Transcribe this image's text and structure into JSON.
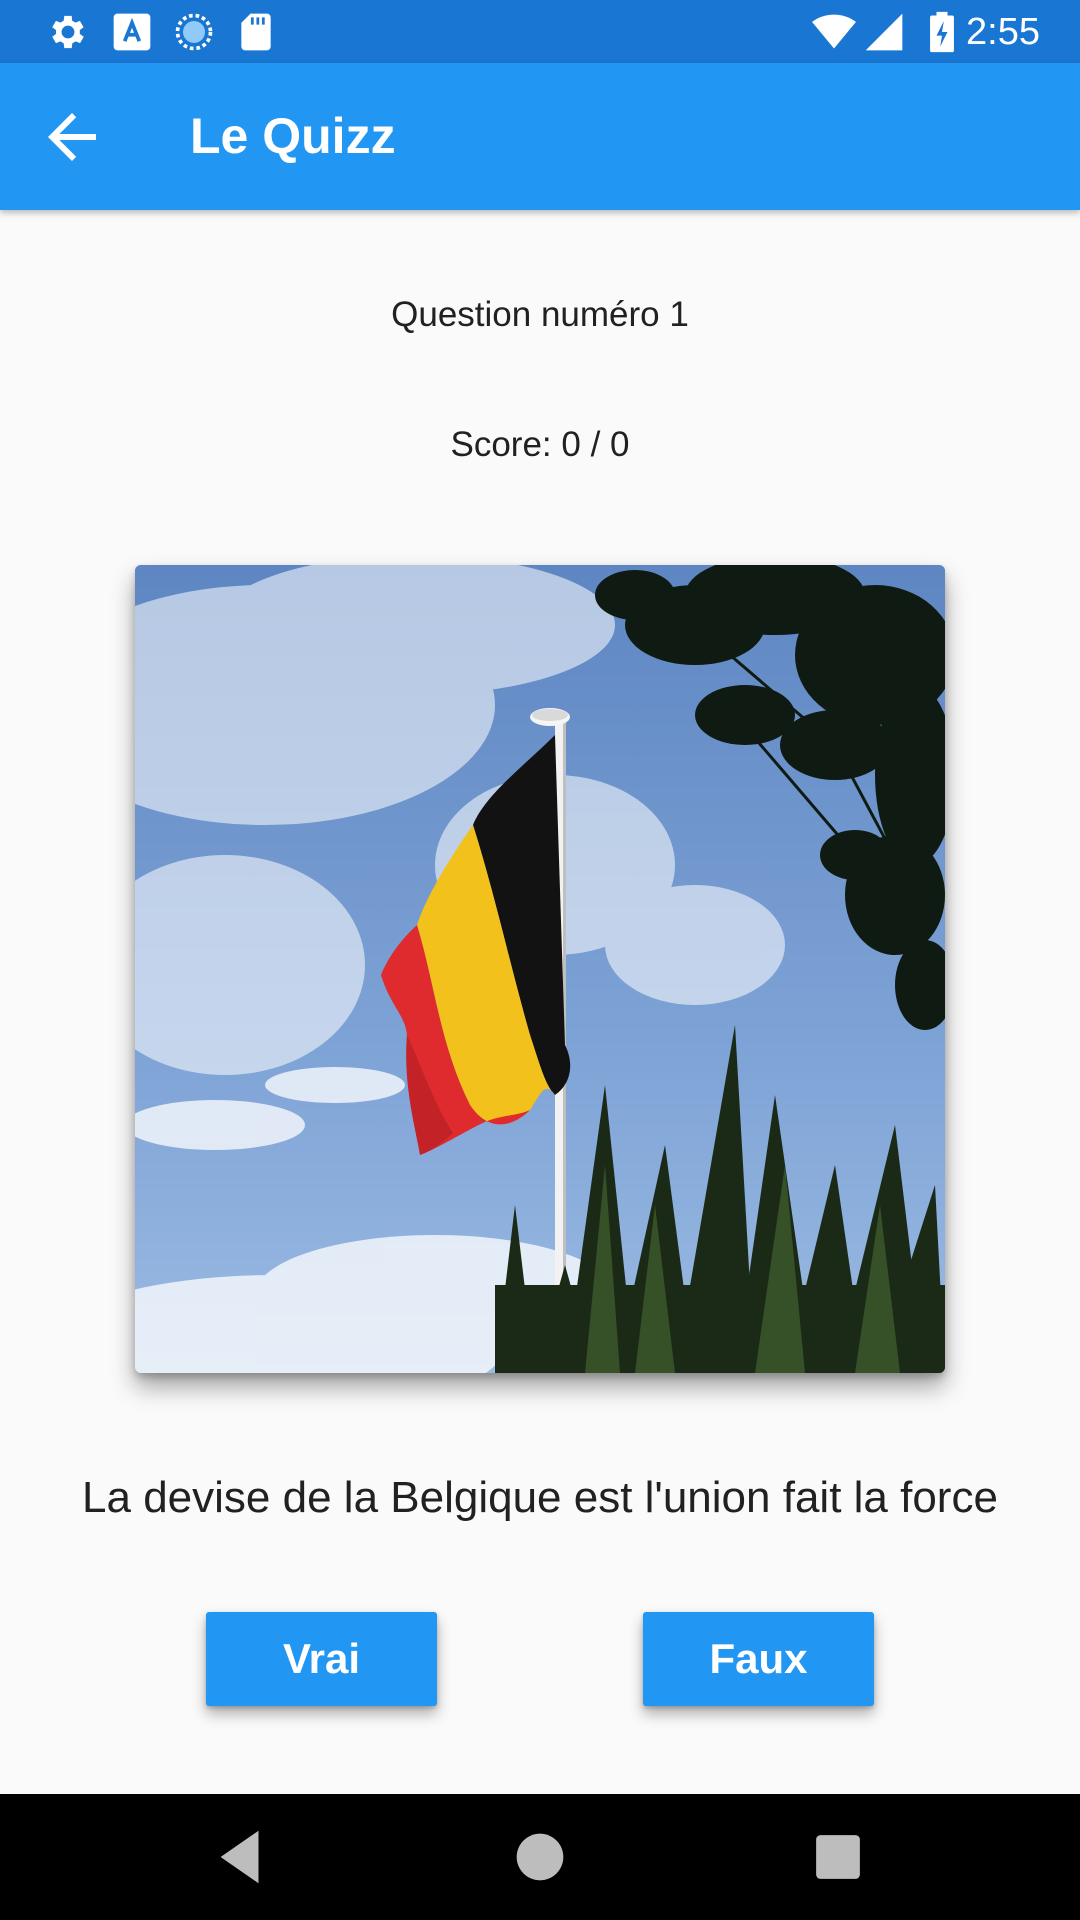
{
  "status_bar": {
    "time": "2:55",
    "left_icons": [
      "gear-icon",
      "font-a-icon",
      "sync-circle-icon",
      "sd-card-icon"
    ],
    "right_icons": [
      "wifi-icon",
      "signal-icon",
      "battery-charging-icon"
    ]
  },
  "app_bar": {
    "title": "Le Quizz",
    "back_icon": "arrow-back-icon"
  },
  "quiz": {
    "question_number": "Question numéro 1",
    "score": "Score: 0 / 0",
    "image_alt": "belgian-flag-photo",
    "question": "La devise de la Belgique est l'union fait la force",
    "true_label": "Vrai",
    "false_label": "Faux"
  },
  "nav_bar": {
    "buttons": [
      "back-triangle-icon",
      "home-circle-icon",
      "recents-square-icon"
    ]
  },
  "colors": {
    "status_bar": "#1976d2",
    "app_bar": "#2196f3",
    "button": "#2196f3",
    "background": "#fafafa",
    "text": "#212121",
    "flag_black": "#111111",
    "flag_yellow": "#f3c11b",
    "flag_red": "#e02a2e"
  }
}
